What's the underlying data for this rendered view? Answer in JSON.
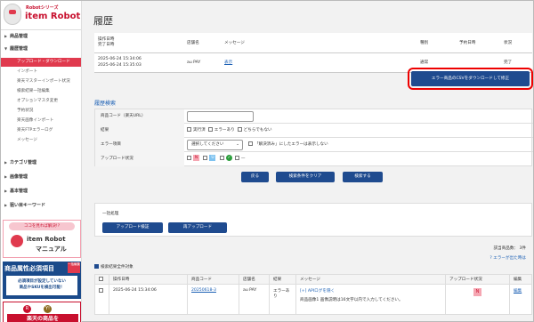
{
  "logo": {
    "series": "Robotシリーズ",
    "name": "item Robot"
  },
  "sidebar": {
    "items": [
      {
        "label": "商品管理"
      },
      {
        "label": "履歴管理"
      },
      {
        "label": "カテゴリ管理"
      },
      {
        "label": "画像管理"
      },
      {
        "label": "基本管理"
      },
      {
        "label": "狙い目キーワード"
      }
    ],
    "subitems": [
      {
        "label": "アップロード・ダウンロード"
      },
      {
        "label": "インポート"
      },
      {
        "label": "楽天マスターインポート状況"
      },
      {
        "label": "検索結果一括編集"
      },
      {
        "label": "オプションマスタ変更"
      },
      {
        "label": "予約状況"
      },
      {
        "label": "楽天画像インポート"
      },
      {
        "label": "楽天FTPエラーログ"
      },
      {
        "label": "メッセージ"
      }
    ]
  },
  "banners": {
    "manual_top": "ココを見れば解決!?",
    "manual_title": "item Robot",
    "manual_sub": "マニュアル",
    "attr_title": "商品属性必須項目",
    "attr_tag": "一括編集",
    "attr_body1": "必須項目が設定していない",
    "attr_body2": "商品やSKUを検出可能！",
    "rakuten_text": "楽天の商品を"
  },
  "page": {
    "title": "履歴"
  },
  "history_table": {
    "headers": [
      "操作日時",
      "店舗名",
      "メッセージ",
      "種別",
      "予約日時",
      "状況"
    ],
    "header_sub": "完了日時",
    "row": {
      "op_date": "2025-06-24 15:34:06",
      "done_date": "2025-06-24 15:35:03",
      "shop": "au PAY",
      "message": "表示",
      "type": "通常",
      "reserve": "",
      "status": "完了"
    }
  },
  "error_csv_button": "エラー商品のCSVをダウンロードして修正",
  "search": {
    "title": "履歴検索",
    "product_code_label": "商品コード（楽天URL）",
    "product_code_value": "",
    "result_label": "結果",
    "result_options": [
      "実行済",
      "エラーあり",
      "どちらでもない"
    ],
    "error_item_label": "エラー項目",
    "error_item_select": "選択してください",
    "error_item_check": "「解決済み」にしたエラーは表示しない",
    "upload_status_label": "アップロード状況",
    "upload_badges": [
      "N",
      "U",
      "✓",
      "—"
    ]
  },
  "buttons": {
    "back": "戻る",
    "clear": "検索条件をクリア",
    "search": "検索する"
  },
  "bulk": {
    "title": "一括処理",
    "verify": "アップロード検証",
    "reupload": "再アップロード"
  },
  "results": {
    "count": "該当商品数： 3件",
    "error_help": "エラーが出た時は",
    "all_check": "検索結果全件対象",
    "headers": [
      "",
      "操作日時",
      "商品コード",
      "店舗名",
      "結果",
      "メッセージ",
      "アップロード状況",
      "編集"
    ],
    "row": {
      "op_date": "2025-06-24 15:34:06",
      "code": "20250618-3",
      "shop": "au PAY",
      "result": "エラーあり",
      "log_link": "[+] APIログを隠く",
      "message": "商品画像1 画像説明は16文字以内で入力してください。",
      "status_badge": "N",
      "edit": "編集"
    }
  }
}
